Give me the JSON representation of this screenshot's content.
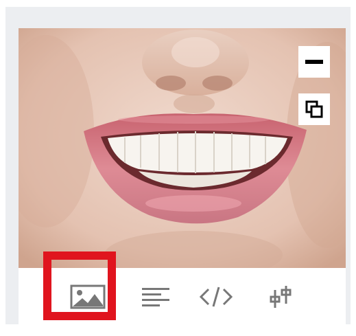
{
  "image_card": {
    "photo": "smiling-mouth-photo",
    "overlay_buttons": [
      "minimize-icon",
      "copy-icon"
    ],
    "toolbar": {
      "tools": [
        "image-icon",
        "text-align-icon",
        "code-icon",
        "sliders-icon"
      ],
      "selected_tool": "image-icon"
    }
  },
  "colors": {
    "panel_background": "#eceef1",
    "card_background": "#ffffff",
    "icon_gray": "#777777",
    "highlight_red": "#e0141e",
    "lip_pink": "#d07984",
    "skin": "#e6c8b8"
  }
}
